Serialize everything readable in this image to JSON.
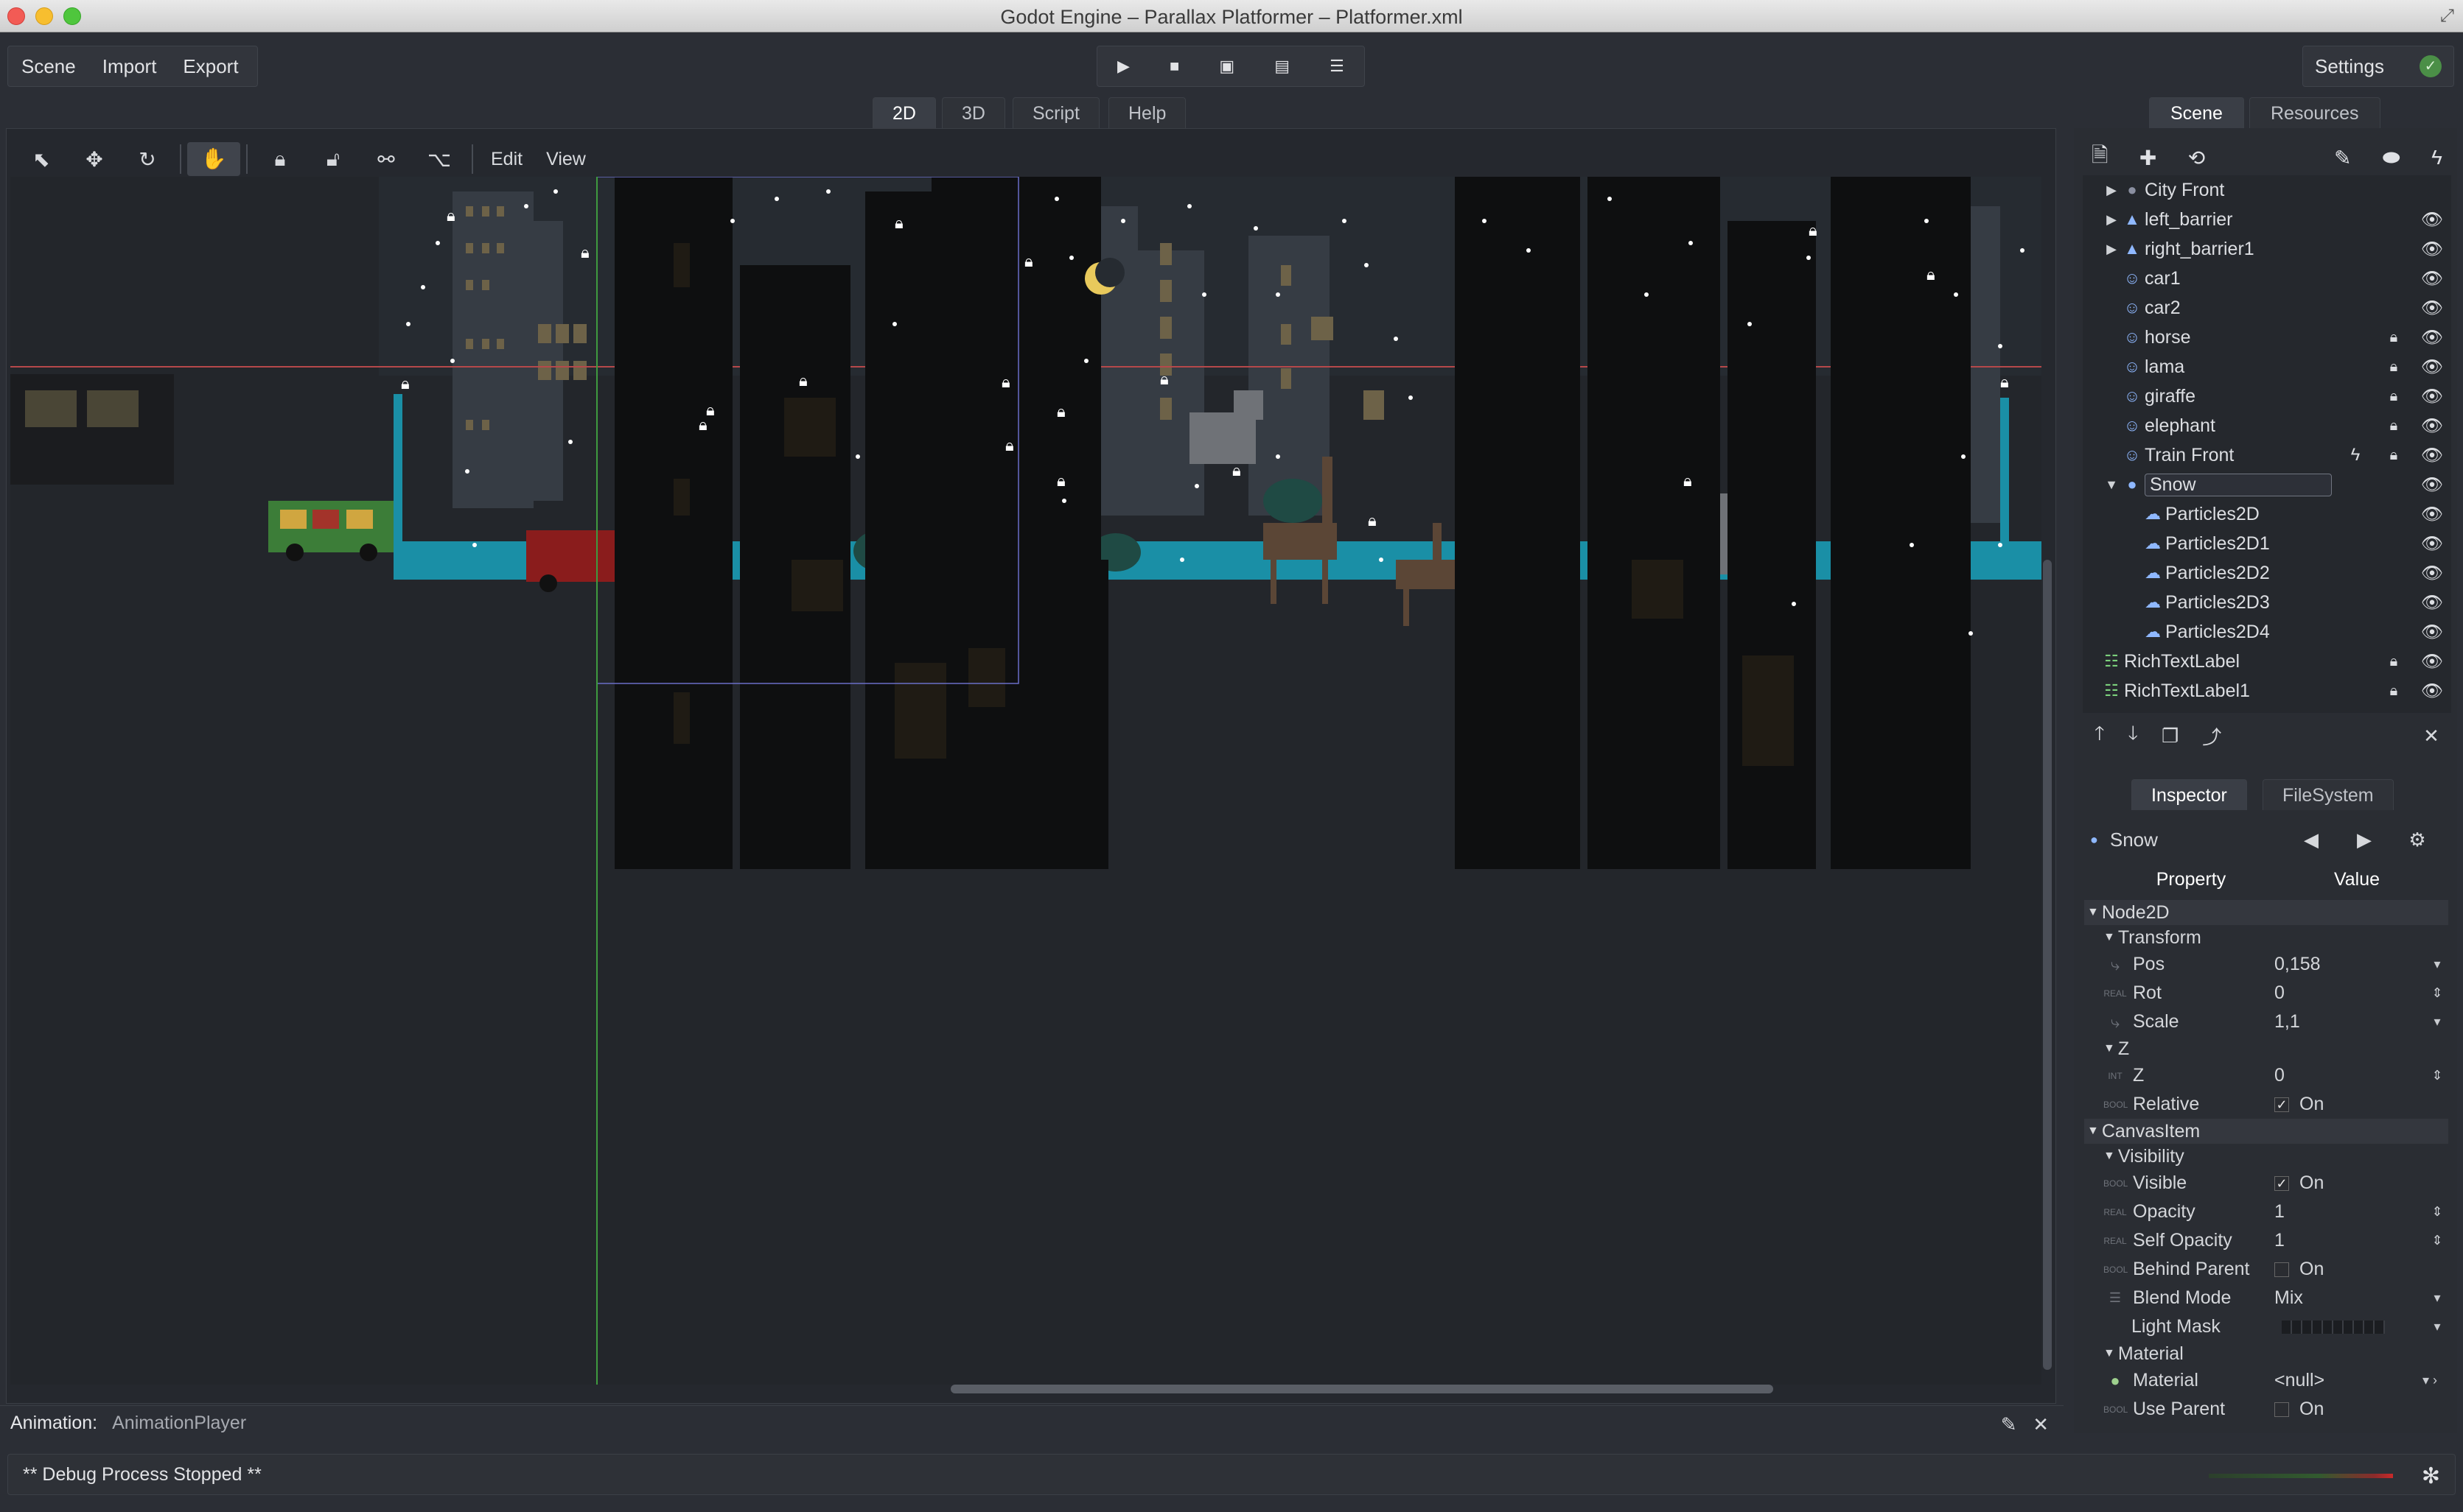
{
  "window": {
    "title": "Godot Engine – Parallax Platformer – Platformer.xml"
  },
  "menu": {
    "items": [
      "Scene",
      "Import",
      "Export"
    ],
    "settings_label": "Settings"
  },
  "playbar": {
    "play": "▶",
    "stop": "■",
    "play_scene": "▣",
    "play_custom": "▤",
    "debug_options": "☰"
  },
  "main_tabs": {
    "tab_2d": "2D",
    "tab_3d": "3D",
    "tab_script": "Script",
    "tab_help": "Help",
    "active": "2D"
  },
  "editor_toolbar": {
    "icons": [
      "select-icon",
      "move-icon",
      "rotate-icon",
      "pan-icon",
      "lock-icon",
      "unlock-icon",
      "bone-icon",
      "ik-chain-icon"
    ],
    "edit_label": "Edit",
    "view_label": "View"
  },
  "scene_panel": {
    "tab_scene": "Scene",
    "tab_resources": "Resources",
    "nodes": [
      {
        "label": "City Front",
        "type": "parallax-layer",
        "expandable": true,
        "depth": 1,
        "lock": false,
        "eye": false,
        "script": false
      },
      {
        "label": "left_barrier",
        "type": "polygon",
        "expandable": true,
        "depth": 1,
        "lock": false,
        "eye": true,
        "script": false
      },
      {
        "label": "right_barrier1",
        "type": "polygon",
        "expandable": true,
        "depth": 1,
        "lock": false,
        "eye": true,
        "script": false
      },
      {
        "label": "car1",
        "type": "sprite",
        "expandable": false,
        "depth": 1,
        "lock": false,
        "eye": true,
        "script": false
      },
      {
        "label": "car2",
        "type": "sprite",
        "expandable": false,
        "depth": 1,
        "lock": false,
        "eye": true,
        "script": false
      },
      {
        "label": "horse",
        "type": "sprite",
        "expandable": false,
        "depth": 1,
        "lock": true,
        "eye": true,
        "script": false
      },
      {
        "label": "lama",
        "type": "sprite",
        "expandable": false,
        "depth": 1,
        "lock": true,
        "eye": true,
        "script": false
      },
      {
        "label": "giraffe",
        "type": "sprite",
        "expandable": false,
        "depth": 1,
        "lock": true,
        "eye": true,
        "script": false
      },
      {
        "label": "elephant",
        "type": "sprite",
        "expandable": false,
        "depth": 1,
        "lock": true,
        "eye": true,
        "script": false
      },
      {
        "label": "Train Front",
        "type": "sprite",
        "expandable": false,
        "depth": 1,
        "lock": true,
        "eye": true,
        "script": true
      },
      {
        "label": "Snow",
        "type": "node2d",
        "expandable": true,
        "expanded": true,
        "depth": 1,
        "lock": false,
        "eye": true,
        "script": false,
        "selected": true
      },
      {
        "label": "Particles2D",
        "type": "particles",
        "expandable": false,
        "depth": 2,
        "lock": false,
        "eye": true,
        "script": false
      },
      {
        "label": "Particles2D1",
        "type": "particles",
        "expandable": false,
        "depth": 2,
        "lock": false,
        "eye": true,
        "script": false
      },
      {
        "label": "Particles2D2",
        "type": "particles",
        "expandable": false,
        "depth": 2,
        "lock": false,
        "eye": true,
        "script": false
      },
      {
        "label": "Particles2D3",
        "type": "particles",
        "expandable": false,
        "depth": 2,
        "lock": false,
        "eye": true,
        "script": false
      },
      {
        "label": "Particles2D4",
        "type": "particles",
        "expandable": false,
        "depth": 2,
        "lock": false,
        "eye": true,
        "script": false
      },
      {
        "label": "RichTextLabel",
        "type": "richtext",
        "expandable": false,
        "depth": 0,
        "lock": true,
        "eye": true,
        "script": false
      },
      {
        "label": "RichTextLabel1",
        "type": "richtext",
        "expandable": false,
        "depth": 0,
        "lock": true,
        "eye": true,
        "script": false
      }
    ]
  },
  "inspector": {
    "tab_inspector": "Inspector",
    "tab_filesystem": "FileSystem",
    "node_name": "Snow",
    "col_property": "Property",
    "col_value": "Value",
    "rows": [
      {
        "kind": "section",
        "label": "Node2D",
        "level": 0
      },
      {
        "kind": "section",
        "label": "Transform",
        "level": 1
      },
      {
        "kind": "prop",
        "type": "vec",
        "name": "Pos",
        "value": "0,158",
        "ctrl": "dropdown"
      },
      {
        "kind": "prop",
        "type": "REAL",
        "name": "Rot",
        "value": "0",
        "ctrl": "spin"
      },
      {
        "kind": "prop",
        "type": "vec",
        "name": "Scale",
        "value": "1,1",
        "ctrl": "dropdown"
      },
      {
        "kind": "section",
        "label": "Z",
        "level": 1
      },
      {
        "kind": "prop",
        "type": "INT",
        "name": "Z",
        "value": "0",
        "ctrl": "spin"
      },
      {
        "kind": "prop",
        "type": "BOOL",
        "name": "Relative",
        "value": "On",
        "checked": true,
        "ctrl": "check"
      },
      {
        "kind": "section",
        "label": "CanvasItem",
        "level": 0
      },
      {
        "kind": "section",
        "label": "Visibility",
        "level": 1
      },
      {
        "kind": "prop",
        "type": "BOOL",
        "name": "Visible",
        "value": "On",
        "checked": true,
        "ctrl": "check"
      },
      {
        "kind": "prop",
        "type": "REAL",
        "name": "Opacity",
        "value": "1",
        "ctrl": "spin"
      },
      {
        "kind": "prop",
        "type": "REAL",
        "name": "Self Opacity",
        "value": "1",
        "ctrl": "spin"
      },
      {
        "kind": "prop",
        "type": "BOOL",
        "name": "Behind Parent",
        "value": "On",
        "checked": false,
        "ctrl": "check"
      },
      {
        "kind": "prop",
        "type": "enum",
        "name": "Blend Mode",
        "value": "Mix",
        "ctrl": "dropdown"
      },
      {
        "kind": "prop",
        "type": "",
        "name": "Light Mask",
        "value": "",
        "ctrl": "mask"
      },
      {
        "kind": "section",
        "label": "Material",
        "level": 1
      },
      {
        "kind": "prop",
        "type": "res",
        "name": "Material",
        "value": "<null>",
        "ctrl": "resource"
      },
      {
        "kind": "prop",
        "type": "BOOL",
        "name": "Use Parent",
        "value": "On",
        "checked": false,
        "ctrl": "check"
      }
    ]
  },
  "animation": {
    "label": "Animation:",
    "value": "AnimationPlayer"
  },
  "status": {
    "text": "** Debug Process Stopped **"
  },
  "colors": {
    "accent": "#8fb8ff",
    "guide_red": "#b5484a",
    "guide_green": "#3f9a3f",
    "teal": "#1a8fa6"
  }
}
